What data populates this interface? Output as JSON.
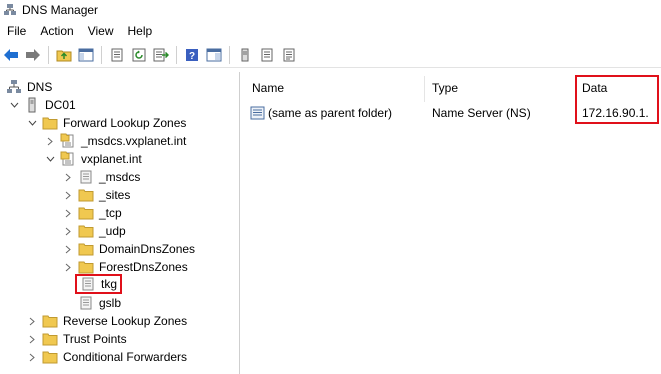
{
  "window": {
    "title": "DNS Manager",
    "icon": "dns-manager-icon"
  },
  "menu": [
    "File",
    "Action",
    "View",
    "Help"
  ],
  "toolbar": [
    "back-arrow-icon",
    "forward-arrow-icon",
    "up-folder-icon",
    "show-hide-tree-icon",
    "properties-icon",
    "refresh-icon",
    "export-list-icon",
    "help-icon",
    "view-icon",
    "server-icon",
    "record-icon",
    "server-alt-icon"
  ],
  "tree": {
    "root": "DNS",
    "server": "DC01",
    "forward_zones": "Forward Lookup Zones",
    "zones": [
      "_msdcs.vxplanet.int",
      "vxplanet.int"
    ],
    "subfolders": [
      "_msdcs",
      "_sites",
      "_tcp",
      "_udp",
      "DomainDnsZones",
      "ForestDnsZones"
    ],
    "selected": "tkg",
    "after_selected": "gslb",
    "other_nodes": [
      "Reverse Lookup Zones",
      "Trust Points",
      "Conditional Forwarders"
    ]
  },
  "list": {
    "columns": [
      "Name",
      "Type",
      "Data"
    ],
    "rows": [
      {
        "name": "(same as parent folder)",
        "type": "Name Server (NS)",
        "data": "172.16.90.1."
      }
    ]
  },
  "colors": {
    "highlight_border": "#e0101a",
    "folder": "#f0c850",
    "arrow_blue": "#1f6fd1"
  }
}
